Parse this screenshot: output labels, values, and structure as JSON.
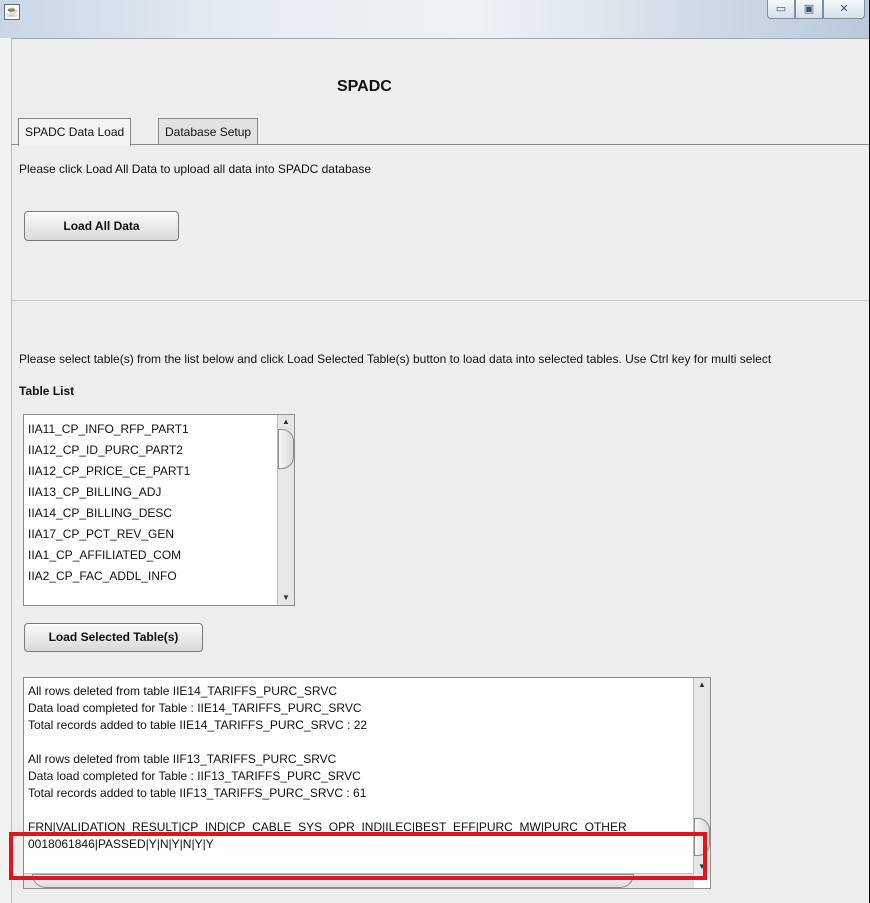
{
  "window": {
    "title": "",
    "app_icon": "java-icon",
    "controls": {
      "minimize": "▭",
      "maximize": "▣",
      "close": "✕"
    }
  },
  "app_title": "SPADC",
  "tabs": [
    {
      "label": "SPADC Data Load",
      "active": true
    },
    {
      "label": "Database Setup",
      "active": false
    }
  ],
  "load_all": {
    "instruction": "Please click Load All Data to upload all data into SPADC database",
    "button_label": "Load All Data"
  },
  "table_section": {
    "instruction": "Please select table(s) from the list below and click Load Selected Table(s) button to load data into selected tables. Use Ctrl key for multi select",
    "list_label": "Table List",
    "tables": [
      "IIA11_CP_INFO_RFP_PART1",
      "IIA12_CP_ID_PURC_PART2",
      "IIA12_CP_PRICE_CE_PART1",
      "IIA13_CP_BILLING_ADJ",
      "IIA14_CP_BILLING_DESC",
      "IIA17_CP_PCT_REV_GEN",
      "IIA1_CP_AFFILIATED_COM",
      "IIA2_CP_FAC_ADDL_INFO"
    ],
    "load_selected_label": "Load Selected Table(s)"
  },
  "output_log": {
    "group1": [
      "All rows deleted from table IIE14_TARIFFS_PURC_SRVC",
      "Data load completed for Table : IIE14_TARIFFS_PURC_SRVC",
      "Total records added to table IIE14_TARIFFS_PURC_SRVC : 22"
    ],
    "group2": [
      "All rows deleted from table IIF13_TARIFFS_PURC_SRVC",
      "Data load completed for Table : IIF13_TARIFFS_PURC_SRVC",
      "Total records added to table IIF13_TARIFFS_PURC_SRVC : 61"
    ],
    "group3": [
      "FRN|VALIDATION_RESULT|CP_IND|CP_CABLE_SYS_OPR_IND|ILEC|BEST_EFF|PURC_MW|PURC_OTHER",
      "0018061846|PASSED|Y|N|Y|N|Y|Y"
    ]
  },
  "colors": {
    "highlight": "#e0141b"
  }
}
